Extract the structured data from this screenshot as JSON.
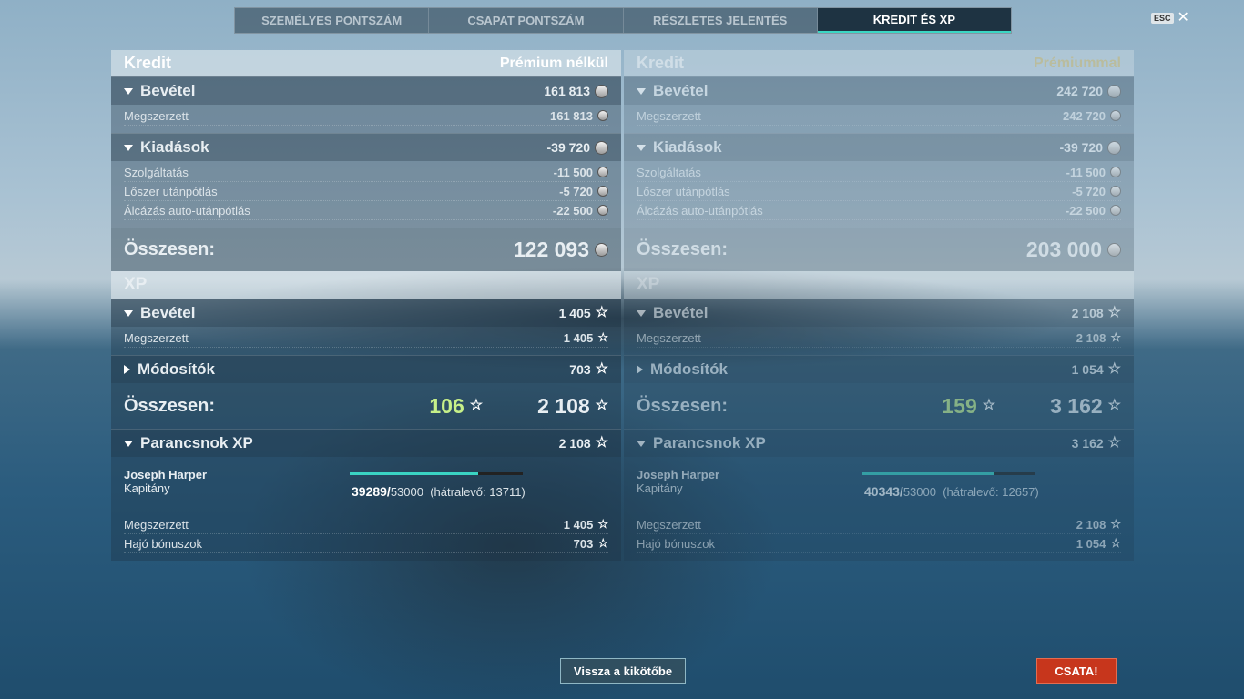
{
  "tabs": [
    "SZEMÉLYES PONTSZÁM",
    "CSAPAT PONTSZÁM",
    "RÉSZLETES JELENTÉS",
    "KREDIT ÉS XP"
  ],
  "esc": "ESC",
  "left": {
    "credit_title": "Kredit",
    "credit_mode": "Prémium nélkül",
    "income_label": "Bevétel",
    "income_val": "161 813",
    "earned_label": "Megszerzett",
    "earned_val": "161 813",
    "expenses_label": "Kiadások",
    "expenses_val": "-39 720",
    "service_label": "Szolgáltatás",
    "service_val": "-11 500",
    "ammo_label": "Lőszer utánpótlás",
    "ammo_val": "-5 720",
    "camo_label": "Álcázás auto-utánpótlás",
    "camo_val": "-22 500",
    "total_label": "Összesen:",
    "total_val": "122 093",
    "xp_title": "XP",
    "xp_income_label": "Bevétel",
    "xp_income_val": "1 405",
    "xp_earned_label": "Megszerzett",
    "xp_earned_val": "1 405",
    "mod_label": "Módosítók",
    "mod_val": "703",
    "xp_total_label": "Összesen:",
    "xp_free": "106",
    "xp_total": "2 108",
    "cmd_label": "Parancsnok XP",
    "cmd_val": "2 108",
    "cmd_name": "Joseph Harper",
    "cmd_rank": "Kapitány",
    "cmd_xp": "39289/",
    "cmd_need": "53000",
    "cmd_remain": "(hátralevő: 13711)",
    "cmd_progress": 0.74,
    "cmd_earned_label": "Megszerzett",
    "cmd_earned_val": "1 405",
    "ship_bonus_label": "Hajó bónuszok",
    "ship_bonus_val": "703"
  },
  "right": {
    "credit_title": "Kredit",
    "credit_mode": "Prémiummal",
    "income_label": "Bevétel",
    "income_val": "242 720",
    "earned_label": "Megszerzett",
    "earned_val": "242 720",
    "expenses_label": "Kiadások",
    "expenses_val": "-39 720",
    "service_label": "Szolgáltatás",
    "service_val": "-11 500",
    "ammo_label": "Lőszer utánpótlás",
    "ammo_val": "-5 720",
    "camo_label": "Álcázás auto-utánpótlás",
    "camo_val": "-22 500",
    "total_label": "Összesen:",
    "total_val": "203 000",
    "xp_title": "XP",
    "xp_income_label": "Bevétel",
    "xp_income_val": "2 108",
    "xp_earned_label": "Megszerzett",
    "xp_earned_val": "2 108",
    "mod_label": "Módosítók",
    "mod_val": "1 054",
    "xp_total_label": "Összesen:",
    "xp_free": "159",
    "xp_total": "3 162",
    "cmd_label": "Parancsnok XP",
    "cmd_val": "3 162",
    "cmd_name": "Joseph Harper",
    "cmd_rank": "Kapitány",
    "cmd_xp": "40343/",
    "cmd_need": "53000",
    "cmd_remain": "(hátralevő: 12657)",
    "cmd_progress": 0.76,
    "cmd_earned_label": "Megszerzett",
    "cmd_earned_val": "2 108",
    "ship_bonus_label": "Hajó bónuszok",
    "ship_bonus_val": "1 054"
  },
  "buttons": {
    "back": "Vissza a kikötőbe",
    "battle": "CSATA!"
  }
}
